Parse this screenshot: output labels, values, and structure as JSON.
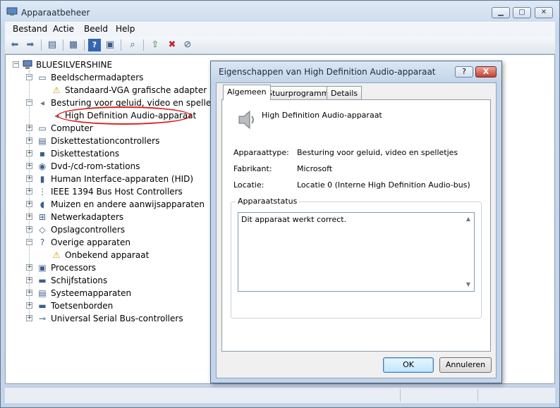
{
  "window": {
    "title": "Apparaatbeheer"
  },
  "menu": [
    "Bestand",
    "Actie",
    "Beeld",
    "Help"
  ],
  "tree": {
    "root": "BLUESILVERSHINE",
    "items": [
      {
        "label": "Beeldschermadapters",
        "level": 1,
        "expanded": true,
        "icon": "monitor-icon"
      },
      {
        "label": "Standaard-VGA grafische adapter",
        "level": 2,
        "icon": "warning-display-icon"
      },
      {
        "label": "Besturing voor geluid, video en spelletjes",
        "level": 1,
        "expanded": true,
        "icon": "speaker-icon"
      },
      {
        "label": "High Definition Audio-apparaat",
        "level": 2,
        "icon": "speaker-icon"
      },
      {
        "label": "Computer",
        "level": 1,
        "icon": "computer-icon"
      },
      {
        "label": "Diskettestationcontrollers",
        "level": 1,
        "icon": "controller-icon"
      },
      {
        "label": "Diskettestations",
        "level": 1,
        "icon": "floppy-icon"
      },
      {
        "label": "Dvd-/cd-rom-stations",
        "level": 1,
        "icon": "dvd-icon"
      },
      {
        "label": "Human Interface-apparaten (HID)",
        "level": 1,
        "icon": "hid-icon"
      },
      {
        "label": "IEEE 1394 Bus Host Controllers",
        "level": 1,
        "icon": "ieee-icon"
      },
      {
        "label": "Muizen en andere aanwijsapparaten",
        "level": 1,
        "icon": "mouse-icon"
      },
      {
        "label": "Netwerkadapters",
        "level": 1,
        "icon": "network-icon"
      },
      {
        "label": "Opslagcontrollers",
        "level": 1,
        "icon": "storage-icon"
      },
      {
        "label": "Overige apparaten",
        "level": 1,
        "expanded": true,
        "icon": "other-devices-icon"
      },
      {
        "label": "Onbekend apparaat",
        "level": 2,
        "icon": "warning-unknown-icon"
      },
      {
        "label": "Processors",
        "level": 1,
        "icon": "processor-icon"
      },
      {
        "label": "Schijfstations",
        "level": 1,
        "icon": "disk-icon"
      },
      {
        "label": "Systeemapparaten",
        "level": 1,
        "icon": "system-icon"
      },
      {
        "label": "Toetsenborden",
        "level": 1,
        "icon": "keyboard-icon"
      },
      {
        "label": "Universal Serial Bus-controllers",
        "level": 1,
        "icon": "usb-icon"
      }
    ]
  },
  "dialog": {
    "title": "Eigenschappen van High Definition Audio-apparaat",
    "help": "?",
    "close": "X",
    "tabs": [
      "Algemeen",
      "Stuurprogramma",
      "Details"
    ],
    "device_name": "High Definition Audio-apparaat",
    "props": [
      {
        "label": "Apparaattype:",
        "value": "Besturing voor geluid, video en spelletjes"
      },
      {
        "label": "Fabrikant:",
        "value": "Microsoft"
      },
      {
        "label": "Locatie:",
        "value": "Locatie 0 (Interne High Definition Audio-bus)"
      }
    ],
    "status_group": "Apparaatstatus",
    "status_text": "Dit apparaat werkt correct.",
    "ok": "OK",
    "cancel": "Annuleren"
  },
  "colors": {
    "highlight_ellipse": "#dd2222",
    "window_bg": "#c9d9ec"
  }
}
